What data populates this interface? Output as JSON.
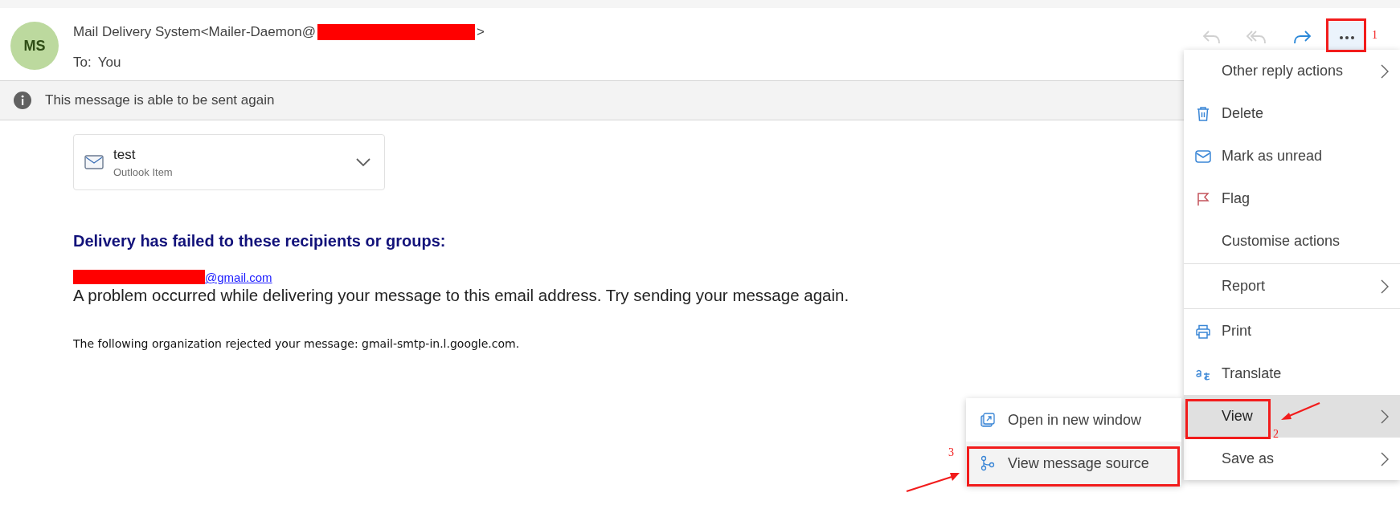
{
  "message": {
    "initials": "MS",
    "sender": "Mail Delivery System<Mailer-Daemon@",
    "sender_end": ">",
    "to_label": "To:",
    "to": "You"
  },
  "toolbar": [
    {
      "kind": "reply",
      "disabled": true,
      "selected": false
    },
    {
      "kind": "reply_all",
      "disabled": true,
      "selected": false
    },
    {
      "kind": "forward",
      "disabled": false,
      "selected": false
    },
    {
      "kind": "more",
      "disabled": false,
      "selected": true
    }
  ],
  "info_bar": "This message is able to be sent again",
  "attachment": {
    "name": "test",
    "type": "Outlook Item"
  },
  "body": {
    "heading": "Delivery has failed to these recipients or groups:",
    "recipient": "@gmail.com",
    "problem": "A problem occurred while delivering your message to this email address. Try sending your message again.",
    "rejection": "The following organization rejected your message: gmail-smtp-in.l.google.com."
  },
  "menu": {
    "groups": [
      [
        {
          "label": "Other reply actions",
          "kind": "plain",
          "submenu": true,
          "selected": false
        },
        {
          "label": "Delete",
          "kind": "trash",
          "submenu": false,
          "selected": false
        },
        {
          "label": "Mark as unread",
          "kind": "mail",
          "submenu": false,
          "selected": false
        },
        {
          "label": "Flag",
          "kind": "flag",
          "submenu": false,
          "selected": false
        },
        {
          "label": "Customise actions",
          "kind": "plain",
          "submenu": false,
          "selected": false
        }
      ],
      [
        {
          "label": "Report",
          "kind": "plain",
          "submenu": true,
          "selected": false
        }
      ],
      [
        {
          "label": "Print",
          "kind": "print",
          "submenu": false,
          "selected": false
        },
        {
          "label": "Translate",
          "kind": "translate",
          "submenu": false,
          "selected": false
        },
        {
          "label": "View",
          "kind": "plain",
          "submenu": true,
          "selected": true
        },
        {
          "label": "Save as",
          "kind": "plain",
          "submenu": true,
          "selected": false
        }
      ]
    ]
  },
  "submenu": {
    "items": [
      {
        "label": "Open in new window",
        "kind": "window",
        "selected": false
      },
      {
        "label": "View message source",
        "kind": "source",
        "selected": true
      }
    ]
  },
  "annotations": [
    {
      "label": "1"
    },
    {
      "label": "2"
    },
    {
      "label": "3"
    }
  ]
}
